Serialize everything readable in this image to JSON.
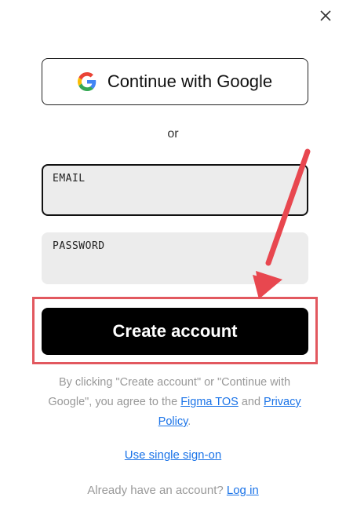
{
  "dialog": {
    "close_icon": "close-icon",
    "google_button_label": "Continue with Google",
    "google_icon": "google-logo-icon",
    "or_text": "or",
    "email_label": "EMAIL",
    "password_label": "PASSWORD",
    "create_button_label": "Create account",
    "legal": {
      "part1": "By clicking \"Create account\" or \"Continue with Google\", you agree to the ",
      "tos_link": "Figma TOS",
      "part2": " and ",
      "privacy_link": "Privacy Policy",
      "part3": "."
    },
    "sso_link": "Use single sign-on",
    "already_text": "Already have an account? ",
    "login_link": "Log in"
  },
  "annotation": {
    "arrow_color": "#e8474f",
    "highlight_color": "#e2585f",
    "arrow_icon": "red-arrow-annotation"
  },
  "colors": {
    "primary_button": "#000000",
    "link": "#1a73e8",
    "field_background": "#ececec"
  }
}
